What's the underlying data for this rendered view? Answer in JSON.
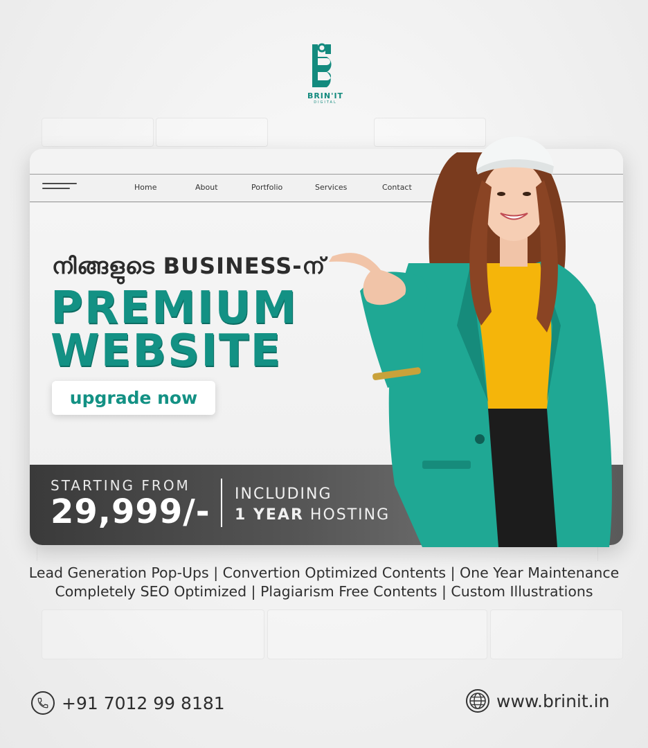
{
  "brand": {
    "name": "BRIN'IT",
    "sub": "DIGITAL"
  },
  "nav": {
    "items": [
      "Home",
      "About",
      "Portfolio",
      "Services",
      "Contact"
    ]
  },
  "hero": {
    "tagline": "നിങ്ങളുടെ BUSINESS-ന്",
    "line1": "PREMIUM",
    "line2": "WEBSITE",
    "cta": "upgrade now"
  },
  "pricing": {
    "starting": "STARTING FROM",
    "price": "29,999/-",
    "including": "INCLUDING",
    "hosting_bold": "1 YEAR",
    "hosting_rest": " HOSTING"
  },
  "features": {
    "line1": "Lead Generation Pop-Ups | Convertion Optimized Contents | One Year Maintenance",
    "line2": "Completely SEO Optimized | Plagiarism Free Contents | Custom Illustrations"
  },
  "contact": {
    "phone": "+91 7012 99 8181",
    "website": "www.brinit.in"
  },
  "colors": {
    "accent": "#139184",
    "dark": "#3a3a3a",
    "yellow": "#f5b50a"
  },
  "icons": [
    "phone-icon",
    "globe-icon",
    "hamburger-icon"
  ]
}
